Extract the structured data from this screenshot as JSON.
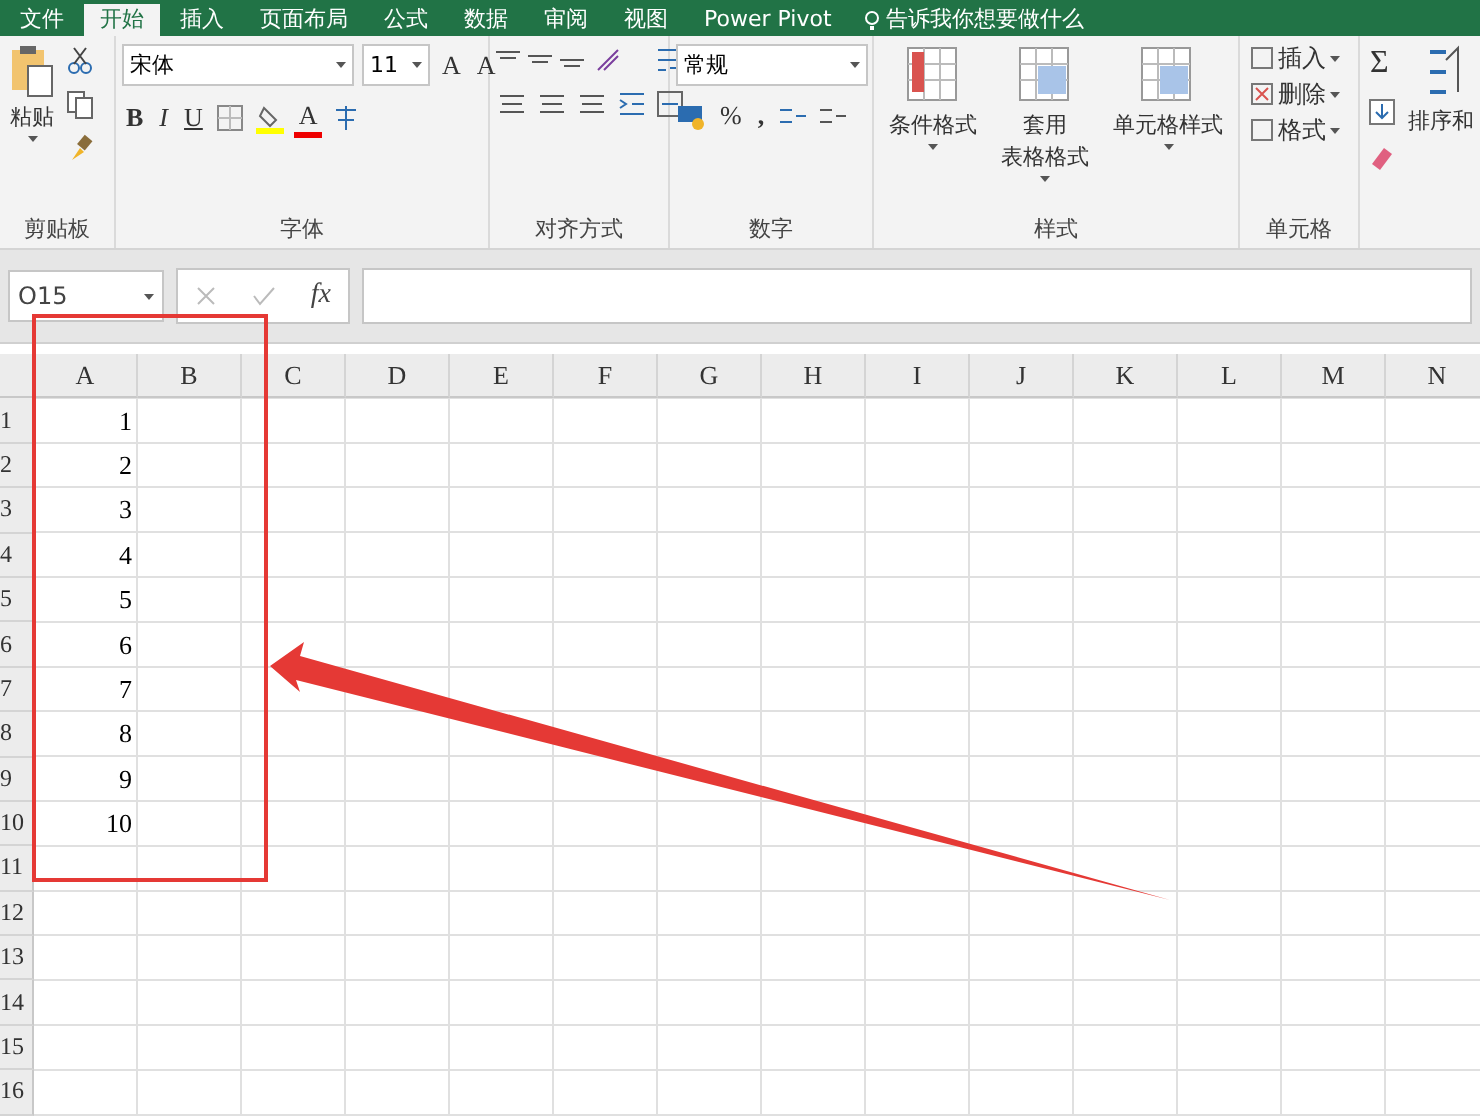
{
  "tabs": [
    {
      "label": "文件",
      "selected": false
    },
    {
      "label": "开始",
      "selected": true
    },
    {
      "label": "插入",
      "selected": false
    },
    {
      "label": "页面布局",
      "selected": false
    },
    {
      "label": "公式",
      "selected": false
    },
    {
      "label": "数据",
      "selected": false
    },
    {
      "label": "审阅",
      "selected": false
    },
    {
      "label": "视图",
      "selected": false
    },
    {
      "label": "Power Pivot",
      "selected": false
    }
  ],
  "tell_me": "告诉我你想要做什么",
  "clipboard": {
    "paste": "粘贴",
    "label": "剪贴板"
  },
  "font": {
    "name": "宋体",
    "size": "11",
    "grow": "A",
    "shrink": "A",
    "bold": "B",
    "italic": "I",
    "underline": "U",
    "color_letter": "A",
    "label": "字体"
  },
  "alignment": {
    "label": "对齐方式"
  },
  "number": {
    "format": "常规",
    "percent": "%",
    "comma": ",",
    "label": "数字"
  },
  "styles": {
    "buttons": [
      "条件格式",
      "套用",
      "单元格样式"
    ],
    "table_format": "表格格式",
    "label": "样式"
  },
  "cells": {
    "items": [
      "插入",
      "删除",
      "格式"
    ],
    "label": "单元格"
  },
  "editing": {
    "sum": "Σ",
    "sort": "排序和"
  },
  "formula_bar": {
    "name_box": "O15",
    "fx": "fx"
  },
  "sheet": {
    "columns": [
      "A",
      "B",
      "C",
      "D",
      "E",
      "F",
      "G",
      "H",
      "I",
      "J",
      "K",
      "L",
      "M",
      "N"
    ],
    "rows": [
      {
        "label": "1",
        "a": "1"
      },
      {
        "label": "2",
        "a": "2"
      },
      {
        "label": "3",
        "a": "3"
      },
      {
        "label": "4",
        "a": "4"
      },
      {
        "label": "5",
        "a": "5"
      },
      {
        "label": "6",
        "a": "6"
      },
      {
        "label": "7",
        "a": "7"
      },
      {
        "label": "8",
        "a": "8"
      },
      {
        "label": "9",
        "a": "9"
      },
      {
        "label": "10",
        "a": "10"
      },
      {
        "label": "11",
        "a": ""
      },
      {
        "label": "12",
        "a": ""
      },
      {
        "label": "13",
        "a": ""
      },
      {
        "label": "14",
        "a": ""
      },
      {
        "label": "15",
        "a": ""
      },
      {
        "label": "16",
        "a": ""
      }
    ]
  }
}
